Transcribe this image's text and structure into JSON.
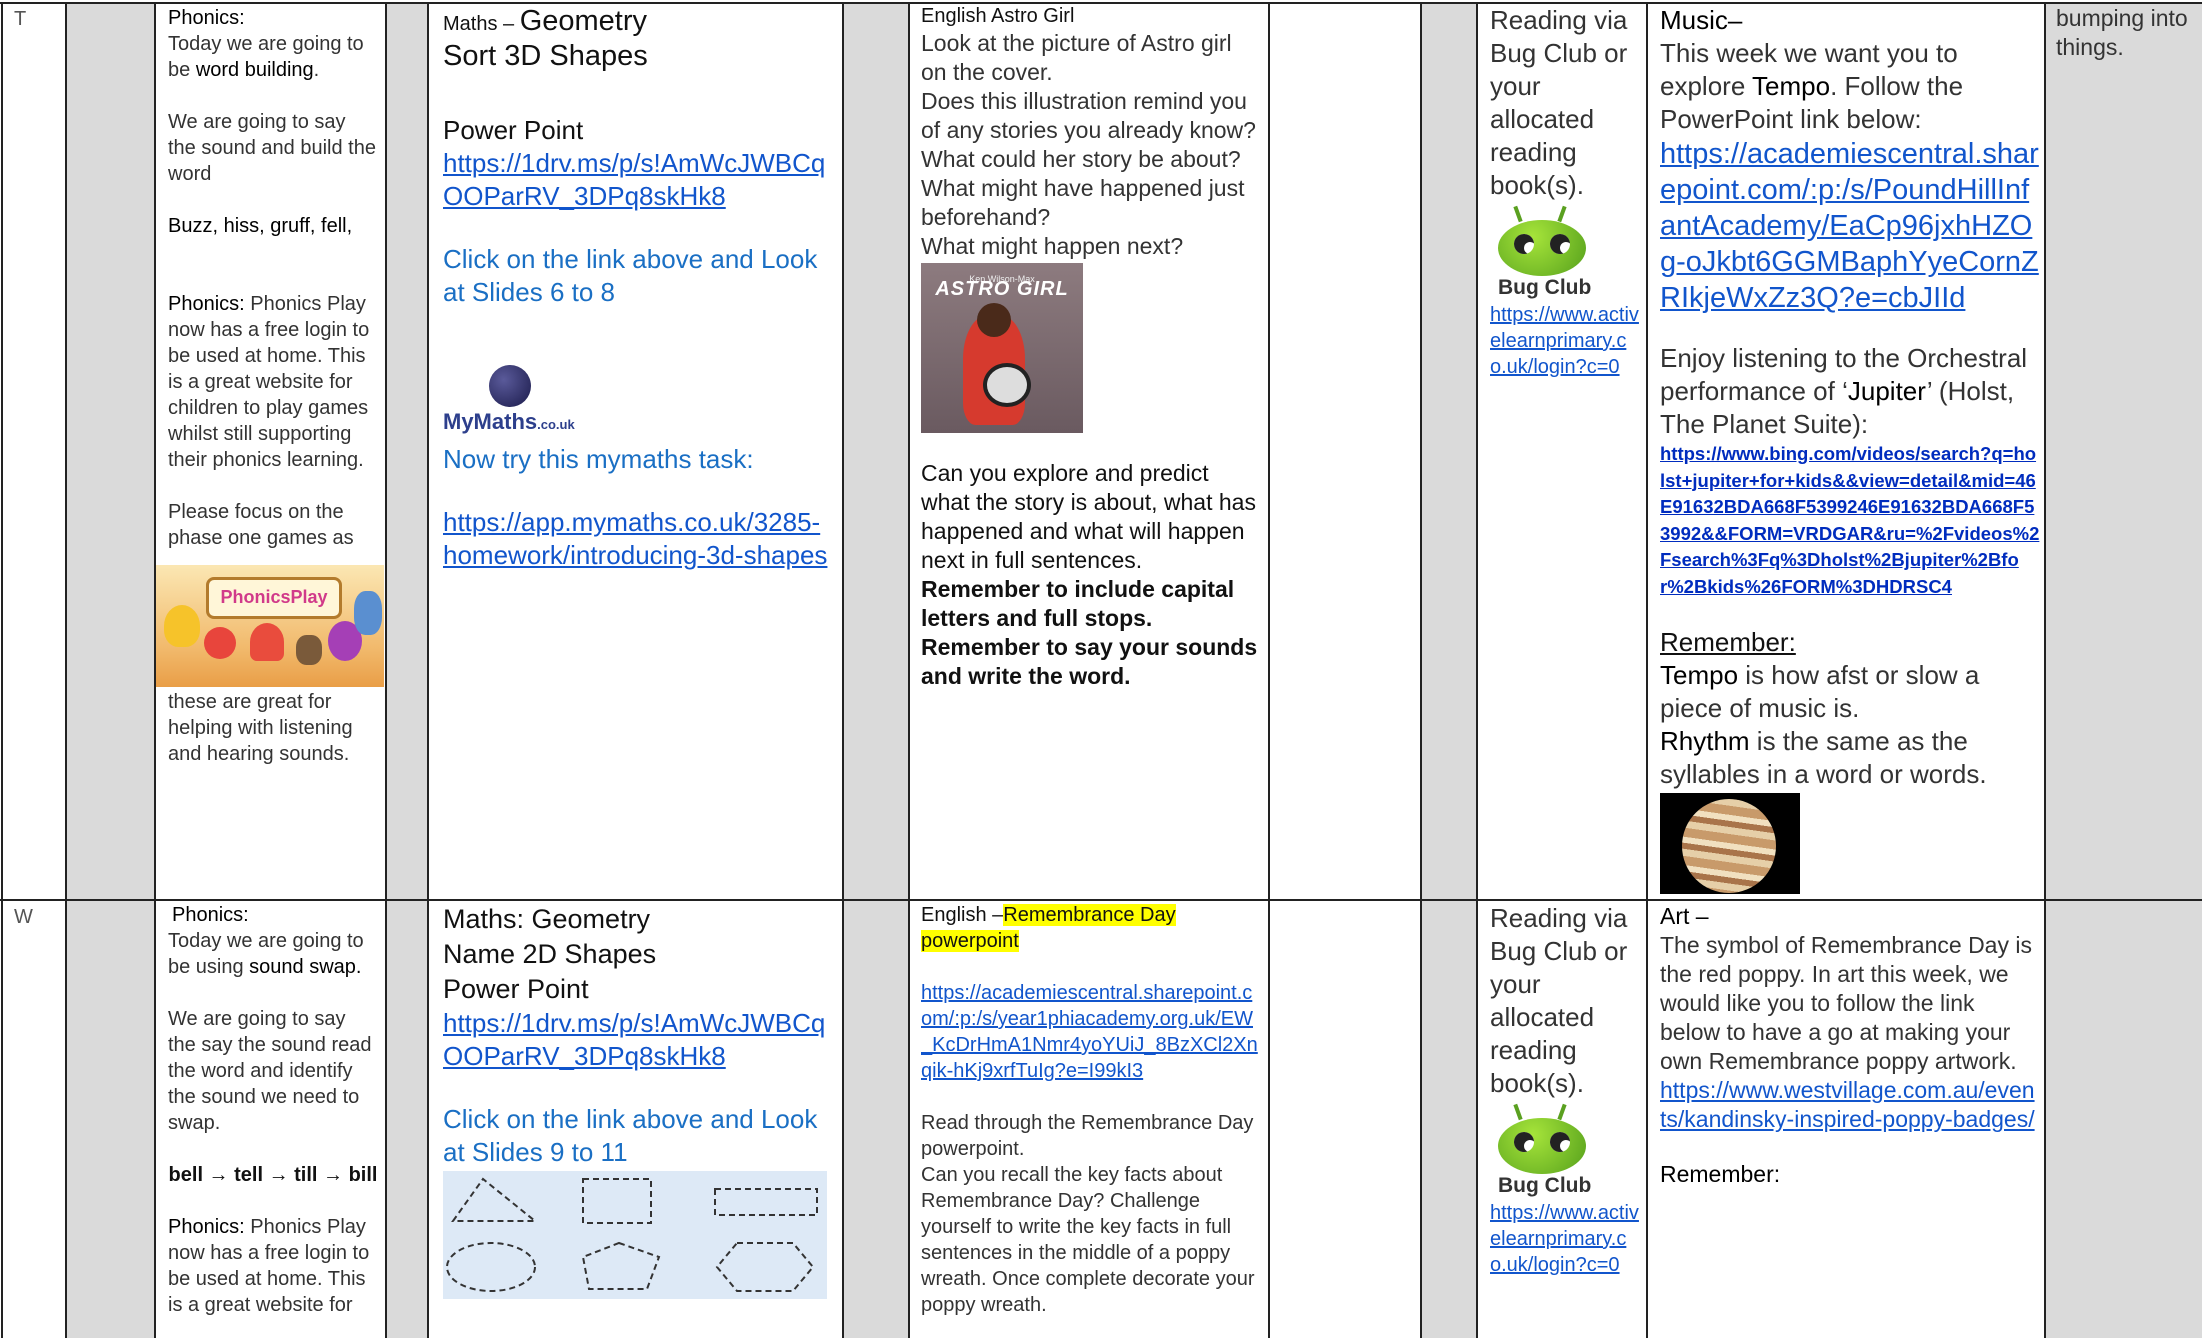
{
  "rows": {
    "t_label": "T",
    "w_label": "W"
  },
  "t_phonics": {
    "title": "Phonics:",
    "intro_pre": "Today we are going to be ",
    "intro_bold": "word building",
    "intro_post": ".",
    "say": "We are going to say the sound and build the word",
    "words": "Buzz, hiss, gruff, fell,",
    "play_label": "Phonics:",
    "play_text": " Phonics Play now has a free login to be used at home. This is a great website for children to play games whilst still supporting their phonics learning.",
    "focus": "Please focus on the phase one games as",
    "logo_text": "PhonicsPlay",
    "after": "these are great for helping with listening and hearing sounds."
  },
  "t_maths": {
    "prefix": "Maths – ",
    "title1": "Geometry",
    "title2": "Sort 3D Shapes",
    "pp": "Power Point",
    "link": "https://1drv.ms/p/s!AmWcJWBCqOOParRV_3DPq8skHk8",
    "click": "Click on the link above and Look at Slides 6 to 8",
    "mymaths_logo": "MyMaths",
    "mymaths_suffix": ".co.uk",
    "try": "Now try this mymaths task:",
    "task_link": "https://app.mymaths.co.uk/3285-homework/introducing-3d-shapes"
  },
  "t_english": {
    "title": "English  Astro Girl",
    "q1": "Look at the picture of Astro girl on the cover.",
    "q2": "Does this illustration remind you of any stories you already know?",
    "q3": "What could her story be about?",
    "q4": "What might have happened just beforehand?",
    "q5": "What might happen next?",
    "book_title": "ASTRO GIRL",
    "book_author": "Ken Wilson-Max",
    "explore": "Can you explore and predict what the story is about, what has happened and what will happen next in full sentences.",
    "r1": " Remember to include capital letters and full stops.",
    "r2": "Remember to say your sounds and write the word."
  },
  "t_reading": {
    "text": "Reading via Bug Club or your allocated reading book(s).",
    "logo": "Bug Club",
    "link": "https://www.activelearnprimary.co.uk/login?c=0"
  },
  "t_music": {
    "title": "Music–",
    "l1_pre": "This week we want you to explore ",
    "l1_bold": "Tempo",
    "l1_post": ". Follow the PowerPoint link below:",
    "link1": "https://academiescentral.sharepoint.com/:p:/s/PoundHillInfantAcademy/EaCp96jxhHZOg-oJkbt6GGMBaphYyeCornZRIkjeWxZz3Q?e=cbJIId",
    "enjoy_pre": "Enjoy listening to the  Orchestral performance of ‘",
    "enjoy_bold": "Jupiter",
    "enjoy_post": "’ (Holst, The Planet Suite):",
    "link2": "https://www.bing.com/videos/search?q=holst+jupiter+for+kids&&view=detail&mid=46E91632BDA668F5399246E91632BDA668F53992&&FORM=VRDGAR&ru=%2Fvideos%2Fsearch%3Fq%3Dholst%2Bjupiter%2Bfor%2Bkids%26FORM%3DHDRSC4",
    "remember": "Remember:",
    "tempo_bold": "Tempo",
    "tempo_text": " is how afst or slow a piece of music is.",
    "rhythm_bold": "Rhythm",
    "rhythm_text": " is the same as the syllables in a word or words."
  },
  "t_last": {
    "text": "bumping into things."
  },
  "w_phonics": {
    "title": "Phonics:",
    "intro_pre": "Today we are going to be using ",
    "intro_bold": "sound swap.",
    "say": "We are going to say the say the sound read the word and identify the sound we need to swap.",
    "chain": "bell → tell → till → bill",
    "play_label": "Phonics:",
    "play_text": " Phonics Play now has a free login to be used at home. This is a great website for"
  },
  "w_maths": {
    "title1": "Maths:  Geometry",
    "title2": "Name 2D Shapes",
    "pp": "Power Point",
    "link": "https://1drv.ms/p/s!AmWcJWBCqOOParRV_3DPq8skHk8",
    "click": "Click on the link above and Look at Slides 9 to 11"
  },
  "w_english": {
    "prefix": "English –",
    "hl": "Remembrance Day powerpoint",
    "link": "https://academiescentral.sharepoint.com/:p:/s/year1phiacademy.org.uk/EW_KcDrHmA1Nmr4yoYUiJ_8BzXCl2Xnqik-hKj9xrfTuIg?e=I99kI3",
    "read": "Read through the Remembrance Day powerpoint.",
    "recall": "Can you recall the key facts about Remembrance Day?  Challenge yourself to write the key facts in full sentences in the middle of a poppy wreath. Once complete decorate your poppy wreath."
  },
  "w_reading": {
    "text": "Reading via Bug Club or your allocated reading book(s).",
    "logo": "Bug Club",
    "link": "https://www.activelearnprimary.co.uk/login?c=0"
  },
  "w_art": {
    "title": "Art –",
    "text": "The symbol of Remembrance Day is the red poppy. In art this week, we would like you to follow the link below to have a go at making your own Remembrance poppy artwork.",
    "link": "https://www.westvillage.com.au/events/kandinsky-inspired-poppy-badges/",
    "remember": "Remember:"
  }
}
